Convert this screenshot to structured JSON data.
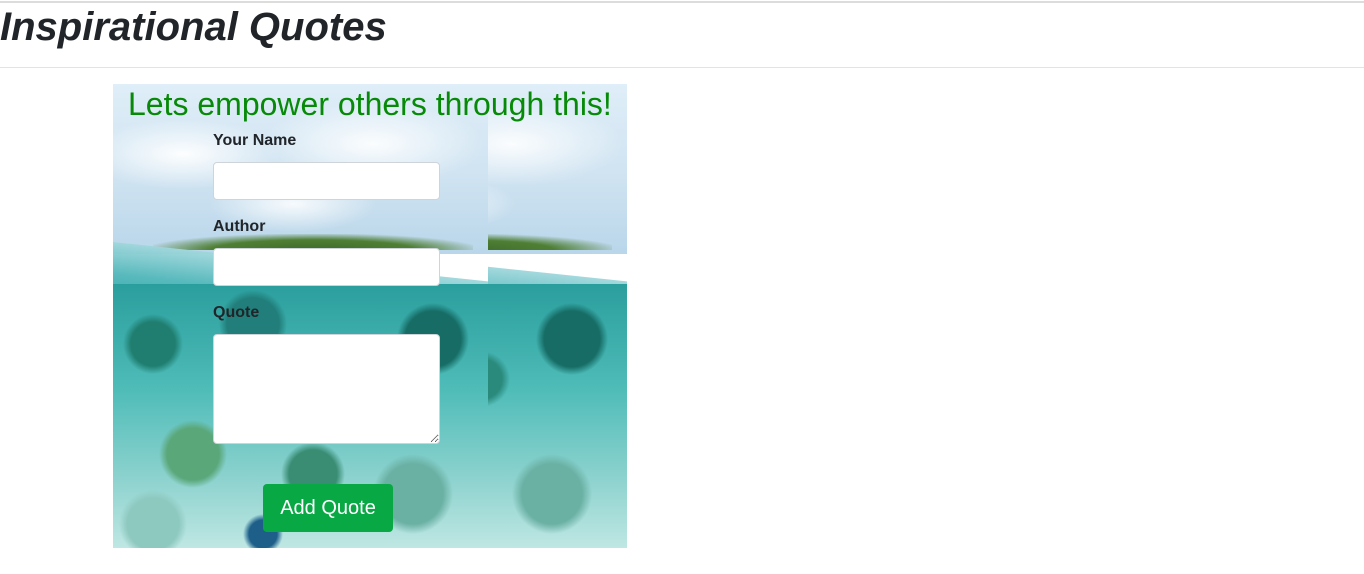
{
  "page": {
    "title": "Inspirational Quotes"
  },
  "form": {
    "headline": "Lets empower others through this!",
    "name_label": "Your Name",
    "name_value": "",
    "author_label": "Author",
    "author_value": "",
    "quote_label": "Quote",
    "quote_value": "",
    "submit_label": "Add Quote"
  },
  "background": {
    "icon": "ocean-reef-photo"
  },
  "colors": {
    "headline": "#078a07",
    "button": "#08a844",
    "button_text": "#ffffff"
  }
}
